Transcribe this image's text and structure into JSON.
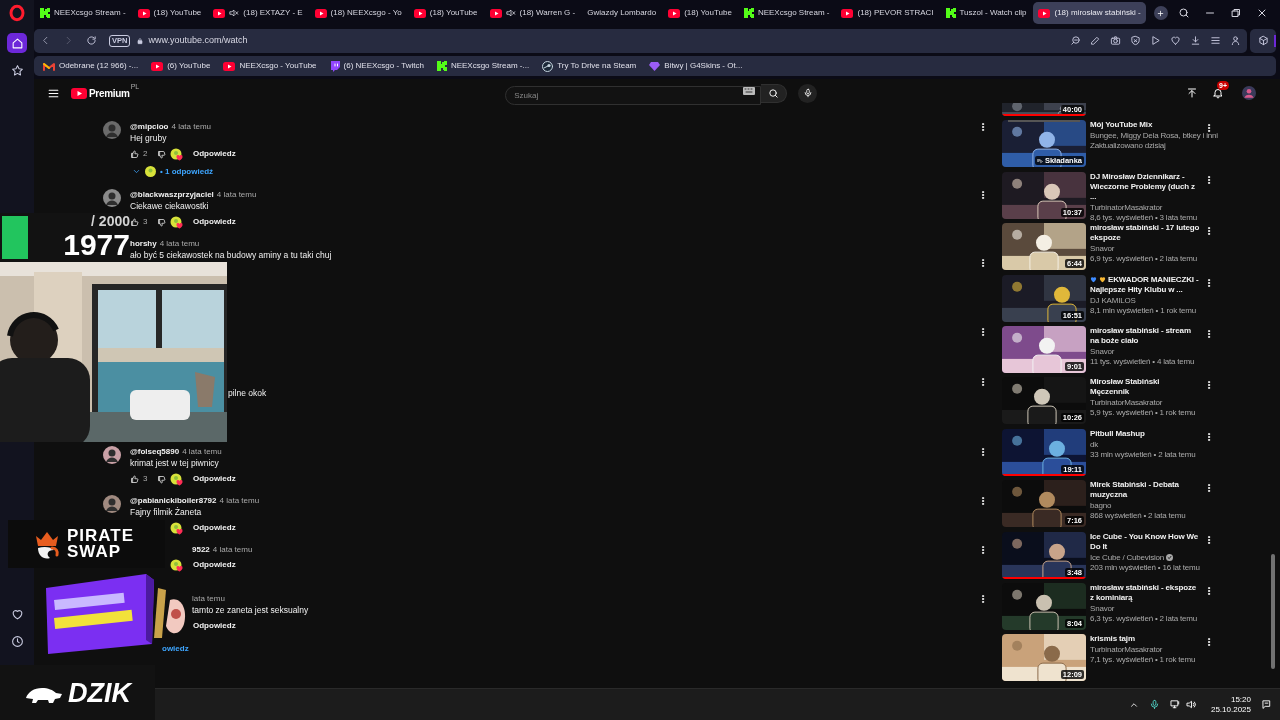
{
  "browser": {
    "sidebar": {
      "top": [
        {
          "kind": "home",
          "selected": true
        },
        {
          "kind": "star",
          "selected": false
        }
      ],
      "bottom": [
        {
          "kind": "heart",
          "selected": false
        },
        {
          "kind": "clock",
          "selected": false
        }
      ]
    },
    "tabs": [
      {
        "kind": "kick",
        "label": "NEEXcsgo Stream -",
        "muted": false,
        "selected": false
      },
      {
        "kind": "youtube",
        "label": "(18) YouTube",
        "muted": false,
        "selected": false
      },
      {
        "kind": "youtube",
        "label": "(18) EXTAZY - E",
        "muted": true,
        "selected": false
      },
      {
        "kind": "youtube",
        "label": "(18) NEEXcsgo - Yo",
        "muted": false,
        "selected": false
      },
      {
        "kind": "youtube",
        "label": "(18) YouTube",
        "muted": false,
        "selected": false
      },
      {
        "kind": "youtube",
        "label": "(18) Warren G -",
        "muted": true,
        "selected": false
      },
      {
        "kind": "none",
        "label": "Gwiazdy Lombardo",
        "muted": false,
        "selected": false
      },
      {
        "kind": "youtube",
        "label": "(18) YouTube",
        "muted": false,
        "selected": false
      },
      {
        "kind": "kick",
        "label": "NEEXcsgo Stream -",
        "muted": false,
        "selected": false
      },
      {
        "kind": "youtube",
        "label": "(18) PEVOR STRACI",
        "muted": false,
        "selected": false
      },
      {
        "kind": "kick",
        "label": "Tuszol - Watch clip",
        "muted": false,
        "selected": false
      },
      {
        "kind": "youtube",
        "label": "(18) mirosław stabiński -",
        "muted": false,
        "selected": true
      }
    ],
    "address": {
      "vpn": "VPN",
      "url": "www.youtube.com/watch"
    },
    "bookmarks": [
      {
        "kind": "mail",
        "label": "Odebrane (12 966) -..."
      },
      {
        "kind": "youtube",
        "label": "(6) YouTube"
      },
      {
        "kind": "youtube",
        "label": "NEEXcsgo - YouTube"
      },
      {
        "kind": "twitch",
        "label": "(6) NEEXcsgo - Twitch"
      },
      {
        "kind": "kick",
        "label": "NEEXcsgo Stream -..."
      },
      {
        "kind": "steam",
        "label": "Try To Drive na Steam"
      },
      {
        "kind": "gem",
        "label": "Bitwy | G4Skins - Ot..."
      }
    ]
  },
  "youtube": {
    "logo": "Premium",
    "region": "PL",
    "search": {
      "placeholder": "Szukaj"
    },
    "notifications": "9+",
    "comments": [
      {
        "kind": "normal",
        "avatar": true,
        "author": "@mipcioo",
        "time": "4 lata temu",
        "text": "Hej gruby",
        "like": true,
        "likes": "2",
        "hearted": true,
        "reply": "Odpowiedz",
        "replies": "• 1 odpowiedź",
        "menu": true
      },
      {
        "kind": "normal",
        "avatar": true,
        "author": "@blackwaszprzyjaciel",
        "time": "4 lata temu",
        "text": "Ciekawe ciekawostki",
        "like": true,
        "likes": "3",
        "hearted": true,
        "reply": "Odpowiedz",
        "menu": true
      },
      {
        "kind": "header",
        "author": "horshy",
        "time": "4 lata temu",
        "text": "ało być 5 ciekawostek na budowy aminy a tu taki chuj",
        "menu": false
      },
      {
        "kind": "hidden-thread",
        "menu": true
      },
      {
        "kind": "hidden",
        "menu": true
      },
      {
        "kind": "fragment",
        "text": "pilne okok",
        "menu": true
      },
      {
        "kind": "normal",
        "avatar": true,
        "author": "@folseq5890",
        "time": "4 lata temu",
        "text": "krimat jest w tej piwnicy",
        "like": true,
        "likes": "3",
        "hearted": true,
        "reply": "Odpowiedz",
        "menu": true
      },
      {
        "kind": "normal",
        "avatar": true,
        "author": "@pabianickiboiler8792",
        "time": "4 lata temu",
        "text": "Fajny filmik Żaneta",
        "like": false,
        "hearted": true,
        "reply": "Odpowiedz",
        "menu": true
      },
      {
        "kind": "cut",
        "author": "9522",
        "time": "4 lata temu",
        "like": false,
        "hearted": true,
        "reply": "Odpowiedz",
        "menu": true
      },
      {
        "kind": "cut",
        "time": "lata temu",
        "text": "tamto ze zaneta jest seksualny",
        "like": false,
        "hearted": false,
        "reply": "Odpowiedz",
        "replies": "owiedz",
        "menu": true
      }
    ],
    "recommendations": [
      {
        "kind": "cut",
        "duration": "40:00",
        "level": 1
      },
      {
        "kind": "mix",
        "title": "Mój YouTube Mix",
        "channel": "Bungee, Miggy Dela Rosa, btkey i inni",
        "meta": "Zaktualizowano dzisiaj",
        "badge": "Składanka",
        "verified": false
      },
      {
        "kind": "video",
        "title": "DJ Mirosław Dziennikarz - Wieczorne Problemy (duch z ...",
        "channel": "TurbinatorMasakrator",
        "meta": "8,6 tys. wyświetleń • 3 lata temu",
        "duration": "10:37",
        "verified": false
      },
      {
        "kind": "video",
        "title": "mirosław stabiński - 17 lutego ekspoze",
        "channel": "Snavor",
        "meta": "6,9 tys. wyświetleń • 2 lata temu",
        "duration": "6:44",
        "verified": false
      },
      {
        "kind": "video",
        "title_hearts": [
          {
            "color": "#3d8bff"
          },
          {
            "color": "#f7b733"
          }
        ],
        "title": "EKWADOR MANIECZKI - Najlepsze Hity Klubu w ...",
        "channel": "DJ KAMILOS",
        "meta": "8,1 mln wyświetleń • 1 rok temu",
        "duration": "16:51",
        "verified": false
      },
      {
        "kind": "video",
        "title": "mirosław stabiński - stream na boże ciało",
        "channel": "Snavor",
        "meta": "11 tys. wyświetleń • 4 lata temu",
        "duration": "9:01",
        "verified": false
      },
      {
        "kind": "video",
        "title": "Mirosław Stabiński Męczennik",
        "channel": "TurbinatorMasakrator",
        "meta": "5,9 tys. wyświetleń • 1 rok temu",
        "duration": "10:26",
        "verified": false
      },
      {
        "kind": "video",
        "title": "Pitbull Mashup",
        "channel": "dk",
        "meta": "33 mln wyświetleń • 2 lata temu",
        "duration": "19:11",
        "level": 1,
        "verified": false
      },
      {
        "kind": "video",
        "title": "Mirek Stabiński - Debata muzyczna",
        "channel": "bagno",
        "meta": "868 wyświetleń • 2 lata temu",
        "duration": "7:16",
        "verified": false
      },
      {
        "kind": "video",
        "title": "Ice Cube - You Know How We Do It",
        "channel": "Ice Cube / Cubevision",
        "meta": "203 mln wyświetleń • 16 lat temu",
        "duration": "3:48",
        "level": 1,
        "verified": true
      },
      {
        "kind": "video",
        "title": "mirosław stabiński - ekspoze z kominiarą",
        "channel": "Snavor",
        "meta": "6,3 tys. wyświetleń • 2 lata temu",
        "duration": "8:04",
        "verified": false
      },
      {
        "kind": "video",
        "title": "krismis tajm",
        "channel": "TurbinatorMasakrator",
        "meta": "7,1 tys. wyświetleń • 1 rok temu",
        "duration": "12:09",
        "verified": false
      }
    ]
  },
  "taskbar": {
    "time": "15:20",
    "date": "25.10.2025"
  },
  "overlays": {
    "counter": {
      "goal": "/ 2000",
      "value": "1977"
    },
    "sponsors": [
      {
        "kind": "pirate",
        "lines": [
          "PIRATE",
          "SWAP"
        ]
      },
      {
        "kind": "dzik",
        "lines": [
          "DZIK"
        ]
      }
    ]
  }
}
